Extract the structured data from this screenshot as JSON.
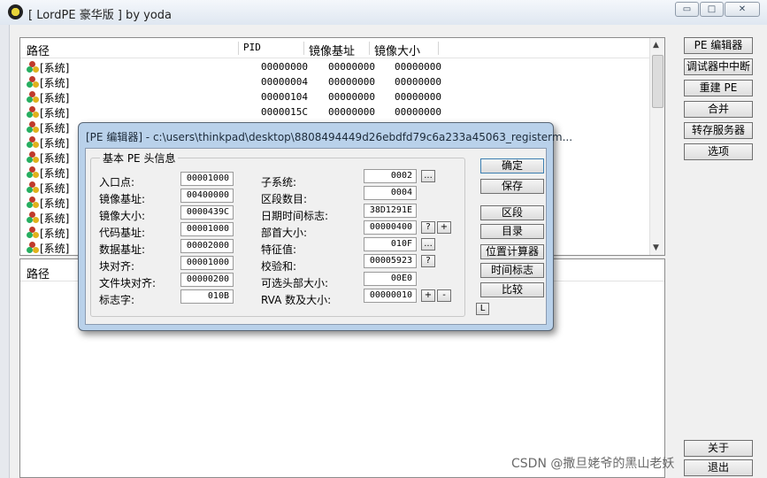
{
  "window": {
    "title": "[ LordPE 豪华版 ] by yoda",
    "controls": [
      "▭",
      "□",
      "✕"
    ]
  },
  "process_list": {
    "columns": [
      "路径",
      "PID",
      "镜像基址",
      "镜像大小"
    ],
    "rows": [
      {
        "path": "[系统]",
        "pid": "00000000",
        "base": "00000000",
        "size": "00000000"
      },
      {
        "path": "[系统]",
        "pid": "00000004",
        "base": "00000000",
        "size": "00000000"
      },
      {
        "path": "[系统]",
        "pid": "00000104",
        "base": "00000000",
        "size": "00000000"
      },
      {
        "path": "[系统]",
        "pid": "0000015C",
        "base": "00000000",
        "size": "00000000"
      },
      {
        "path": "[系统]"
      },
      {
        "path": "[系统]"
      },
      {
        "path": "[系统]"
      },
      {
        "path": "[系统]"
      },
      {
        "path": "[系统]"
      },
      {
        "path": "[系统]"
      },
      {
        "path": "[系统]"
      },
      {
        "path": "[系统]"
      },
      {
        "path": "[系统]"
      }
    ]
  },
  "module_list": {
    "columns": [
      "路径"
    ]
  },
  "side_buttons": [
    "PE 编辑器",
    "调试器中中断",
    "重建 PE",
    "合并",
    "转存服务器",
    "选项"
  ],
  "bottom_buttons": {
    "about": "关于",
    "exit": "退出"
  },
  "dialog": {
    "title": "[PE 编辑器] - c:\\users\\thinkpad\\desktop\\8808494449d26ebdfd79c6a233a45063_registerm...",
    "group_title": "基本 PE 头信息",
    "left_fields": [
      {
        "label": "入口点:",
        "value": "00001000"
      },
      {
        "label": "镜像基址:",
        "value": "00400000"
      },
      {
        "label": "镜像大小:",
        "value": "0000439C"
      },
      {
        "label": "代码基址:",
        "value": "00001000"
      },
      {
        "label": "数据基址:",
        "value": "00002000"
      },
      {
        "label": "块对齐:",
        "value": "00001000"
      },
      {
        "label": "文件块对齐:",
        "value": "00000200"
      },
      {
        "label": "标志字:",
        "value": "010B"
      }
    ],
    "right_fields": [
      {
        "label": "子系统:",
        "value": "0002"
      },
      {
        "label": "区段数目:",
        "value": "0004"
      },
      {
        "label": "日期时间标志:",
        "value": "38D1291E"
      },
      {
        "label": "部首大小:",
        "value": "00000400"
      },
      {
        "label": "特征值:",
        "value": "010F"
      },
      {
        "label": "校验和:",
        "value": "00005923"
      },
      {
        "label": "可选头部大小:",
        "value": "00E0"
      },
      {
        "label": "RVA 数及大小:",
        "value": "00000010"
      }
    ],
    "mini_buttons": {
      "ellipsis": "...",
      "question": "?",
      "plus": "+",
      "minus": "-"
    },
    "buttons": [
      "确定",
      "保存",
      "区段",
      "目录",
      "位置计算器",
      "时间标志",
      "比较"
    ],
    "l_button": "L"
  },
  "watermark": "CSDN @撒旦姥爷的黑山老妖"
}
